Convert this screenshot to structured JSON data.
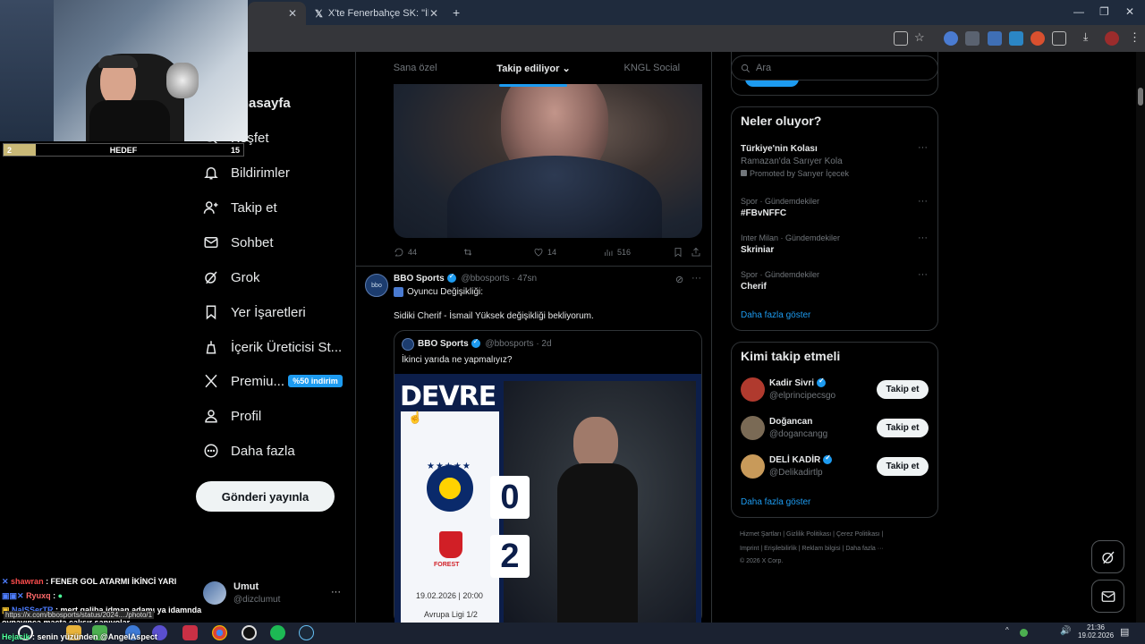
{
  "browser": {
    "tabs": [
      {
        "label": ""
      },
      {
        "label": "X'te Fenerbahçe SK: \"İlk yarı so"
      }
    ],
    "new_tab": "+",
    "window_controls": [
      "—",
      "❐",
      "✕"
    ]
  },
  "overlay": {
    "hedef": {
      "left": "2",
      "label": "HEDEF",
      "right": "15"
    },
    "progress": 0.133
  },
  "nav": {
    "items": [
      {
        "label": "Anasayfa"
      },
      {
        "label": "Keşfet"
      },
      {
        "label": "Bildirimler"
      },
      {
        "label": "Takip et"
      },
      {
        "label": "Sohbet"
      },
      {
        "label": "Grok"
      },
      {
        "label": "Yer İşaretleri"
      },
      {
        "label": "İçerik Üreticisi St..."
      },
      {
        "label": "Premiu..."
      },
      {
        "label": "Profil"
      },
      {
        "label": "Daha fazla"
      }
    ],
    "premium_badge": "%50 indirim",
    "post_button": "Gönderi yayınla",
    "account": {
      "name": "Umut",
      "handle": "@dizclumut",
      "more": "···"
    }
  },
  "feed": {
    "tabs": [
      "Sana özel",
      "Takip ediliyor",
      "KNGL Social"
    ],
    "post1_actions": {
      "replies": "44",
      "retweets": "",
      "likes": "14",
      "views": "516"
    },
    "post2": {
      "author": "BBO Sports",
      "handle": "@bbosports",
      "time": "· 47sn",
      "line1": "Oyuncu Değişikliği:",
      "line2": "Sidiki Cherif -  İsmail Yüksek değişikliği bekliyorum.",
      "quote": {
        "author": "BBO Sports",
        "handle": "@bbosports",
        "time": "· 2d",
        "text": "İkinci yarıda ne yapmalıyız?",
        "graphic": {
          "headline": "DEVRE",
          "score_home": "0",
          "score_away": "2",
          "date": "19.02.2026 | 20:00",
          "competition": "Avrupa Ligi 1/2",
          "away_crest": "FOREST"
        }
      }
    }
  },
  "right": {
    "search_placeholder": "Ara",
    "whats_happening": {
      "title": "Neler oluyor?",
      "trends": [
        {
          "sub": "",
          "title": "Türkiye'nin Kolası",
          "desc": "Ramazan'da Sarıyer Kola",
          "promo": "Promoted by Sarıyer İçecek"
        },
        {
          "sub": "Spor · Gündemdekiler",
          "title": "#FBvNFFC"
        },
        {
          "sub": "Inter Milan · Gündemdekiler",
          "title": "Skriniar"
        },
        {
          "sub": "Spor · Gündemdekiler",
          "title": "Cherif"
        }
      ],
      "show_more": "Daha fazla göster"
    },
    "who_to_follow": {
      "title": "Kimi takip etmeli",
      "users": [
        {
          "name": "Kadir Sivri",
          "handle": "@elprincipecsgo",
          "button": "Takip et",
          "color": "#b03a2e"
        },
        {
          "name": "Doğancan",
          "handle": "@dogancangg",
          "button": "Takip et",
          "color": "#7a6a55"
        },
        {
          "name": "DELİ KADİR",
          "handle": "@Delikadirtlp",
          "button": "Takip et",
          "color": "#c89a5a"
        }
      ],
      "show_more": "Daha fazla göster"
    },
    "footer": {
      "links1": [
        "Hizmet Şartları",
        "|",
        "Gizlilik Politikası",
        "|",
        "Çerez Politikası",
        "|"
      ],
      "links2": [
        "Imprint",
        "|",
        "Erişilebilirlik",
        "|",
        "Reklam bilgisi",
        "|",
        "Daha fazla ···"
      ],
      "copyright": "© 2026 X Corp."
    }
  },
  "chat": [
    {
      "user": "shawran",
      "msg": " : FENER GOL ATARMI İKİNCİ YARI",
      "color": "#ff4d4d"
    },
    {
      "user": "Ryuxq",
      "msg": " : ",
      "color": "#ff6b6b"
    },
    {
      "user": "https://x.com/bbosports/status/2024..../photo/1",
      "msg": "",
      "color": "#ddd"
    },
    {
      "user": "NaISSerTR",
      "msg": " : mert galiba idman adamı ya idamnda",
      "color": "#4d7dff"
    },
    {
      "user": "oynayınca maçta çalışır sanıyolar",
      "msg": "",
      "color": "#fff"
    },
    {
      "user": "Hejacik",
      "msg": " : senin yüzünden @AngelAspect",
      "color": "#4dff9a"
    }
  ],
  "taskbar": {
    "time": "21:36",
    "date": "19.02.2026"
  },
  "colors": {
    "accent": "#1d9bf0",
    "bg": "#000000",
    "border": "#2f3336",
    "muted": "#71767b"
  }
}
